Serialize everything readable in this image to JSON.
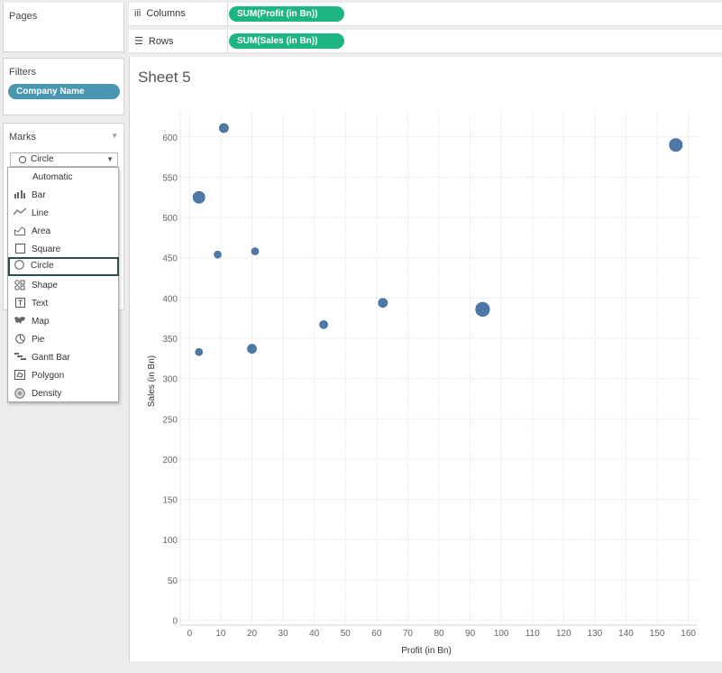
{
  "pages": {
    "title": "Pages"
  },
  "filters": {
    "title": "Filters",
    "pills": [
      "Company Name"
    ]
  },
  "marks": {
    "title": "Marks",
    "selected_type": "Circle",
    "types": [
      {
        "label": "Automatic",
        "icon": ""
      },
      {
        "label": "Bar",
        "icon": "bar-icon"
      },
      {
        "label": "Line",
        "icon": "line-icon"
      },
      {
        "label": "Area",
        "icon": "area-icon"
      },
      {
        "label": "Square",
        "icon": "square-icon"
      },
      {
        "label": "Circle",
        "icon": "circle-icon"
      },
      {
        "label": "Shape",
        "icon": "shape-icon"
      },
      {
        "label": "Text",
        "icon": "text-icon"
      },
      {
        "label": "Map",
        "icon": "map-icon"
      },
      {
        "label": "Pie",
        "icon": "pie-icon"
      },
      {
        "label": "Gantt Bar",
        "icon": "gantt-bar-icon"
      },
      {
        "label": "Polygon",
        "icon": "polygon-icon"
      },
      {
        "label": "Density",
        "icon": "density-icon"
      }
    ]
  },
  "shelves": {
    "columns": {
      "label": "Columns",
      "pill": "SUM(Profit (in Bn))"
    },
    "rows": {
      "label": "Rows",
      "pill": "SUM(Sales (in Bn))"
    }
  },
  "sheet": {
    "title": "Sheet 5"
  },
  "colors": {
    "mark": "#4e79a7",
    "shelf_pill": "#1db583",
    "filter_pill": "#4996b2"
  },
  "chart_data": {
    "type": "scatter",
    "xlabel": "Profit (in Bn)",
    "ylabel": "Sales (in Bn)",
    "xlim": [
      -3,
      163
    ],
    "ylim": [
      -5,
      630
    ],
    "x_ticks": [
      0,
      10,
      20,
      30,
      40,
      50,
      60,
      70,
      80,
      90,
      100,
      110,
      120,
      130,
      140,
      150,
      160
    ],
    "y_ticks": [
      0,
      50,
      100,
      150,
      200,
      250,
      300,
      350,
      400,
      450,
      500,
      550,
      600
    ],
    "grid": true,
    "points": [
      {
        "x": 11,
        "y": 611,
        "size": 2
      },
      {
        "x": 156,
        "y": 590,
        "size": 5
      },
      {
        "x": 3,
        "y": 525,
        "size": 4
      },
      {
        "x": 21,
        "y": 458,
        "size": 1
      },
      {
        "x": 9,
        "y": 454,
        "size": 1
      },
      {
        "x": 62,
        "y": 394,
        "size": 2
      },
      {
        "x": 94,
        "y": 386,
        "size": 6
      },
      {
        "x": 43,
        "y": 367,
        "size": 1.5
      },
      {
        "x": 20,
        "y": 337,
        "size": 2
      },
      {
        "x": 3,
        "y": 333,
        "size": 1
      }
    ]
  }
}
